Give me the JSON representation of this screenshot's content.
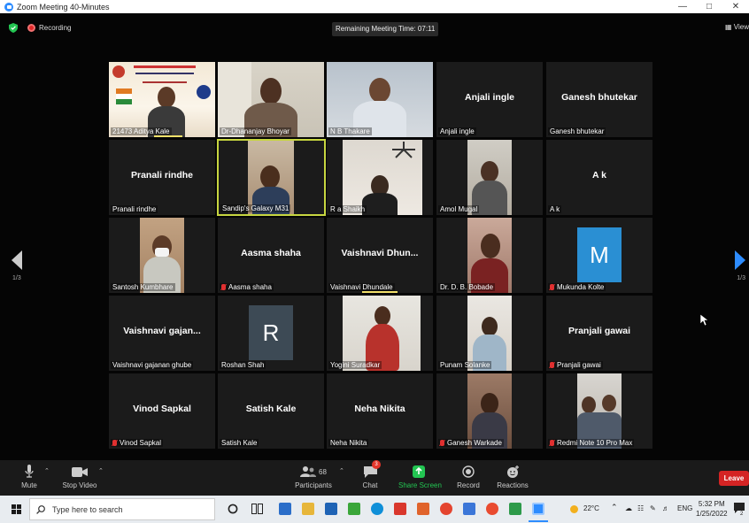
{
  "window": {
    "title": "Zoom Meeting 40-Minutes",
    "controls": [
      "—",
      "□",
      "✕"
    ]
  },
  "topbar": {
    "recording_label": "Recording",
    "remaining_time": "Remaining Meeting Time: 07:11",
    "view_label": "View"
  },
  "pagination": {
    "left": "1/3",
    "right": "1/3"
  },
  "participants": [
    {
      "name": "21473 Aditya Kale"
    },
    {
      "name": "Dr-Dhananjay Bhoyar"
    },
    {
      "name": "N B Thakare"
    },
    {
      "name": "Anjali ingle",
      "display": "Anjali ingle"
    },
    {
      "name": "Ganesh bhutekar",
      "display": "Ganesh bhutekar"
    },
    {
      "name": "Pranali rindhe",
      "display": "Pranali rindhe"
    },
    {
      "name": "Sandip's Galaxy M31"
    },
    {
      "name": "R a Shaikh"
    },
    {
      "name": "Amol Mugal"
    },
    {
      "name": "A k",
      "display": "A k"
    },
    {
      "name": "Santosh Kumbhare"
    },
    {
      "name": "Aasma  shaha",
      "display": "Aasma  shaha"
    },
    {
      "name": "Vaishnavi Dhundale",
      "display": "Vaishnavi  Dhun..."
    },
    {
      "name": "Dr. D. B. Bobade"
    },
    {
      "name": "Mukunda Kolte",
      "letter": "M"
    },
    {
      "name": "Vaishnavi gajanan ghube",
      "display": "Vaishnavi  gajan..."
    },
    {
      "name": "Roshan Shah",
      "letter": "R"
    },
    {
      "name": "Yogini Suradkar"
    },
    {
      "name": "Punam Solanke"
    },
    {
      "name": "Pranjali gawai",
      "display": "Pranjali gawai"
    },
    {
      "name": "Vinod Sapkal",
      "display": "Vinod Sapkal"
    },
    {
      "name": "Satish Kale",
      "display": "Satish Kale"
    },
    {
      "name": "Neha Nikita",
      "display": "Neha Nikita"
    },
    {
      "name": "Ganesh Warkade"
    },
    {
      "name": "Redmi Note 10 Pro Max"
    }
  ],
  "controls": {
    "mute": "Mute",
    "stop_video": "Stop Video",
    "participants": "Participants",
    "participants_count": "68",
    "chat": "Chat",
    "chat_badge": "3",
    "share_screen": "Share Screen",
    "record": "Record",
    "reactions": "Reactions",
    "leave": "Leave"
  },
  "taskbar": {
    "search_placeholder": "Type here to search",
    "weather": "22°C",
    "language": "ENG",
    "time": "5:32 PM",
    "date": "1/25/2022",
    "notification_count": "2"
  },
  "colors": {
    "active_speaker": "#c7d640",
    "leave": "#d42424",
    "share": "#23c552",
    "recording": "#e02828",
    "avatar_bg": "#2a8fd3"
  }
}
